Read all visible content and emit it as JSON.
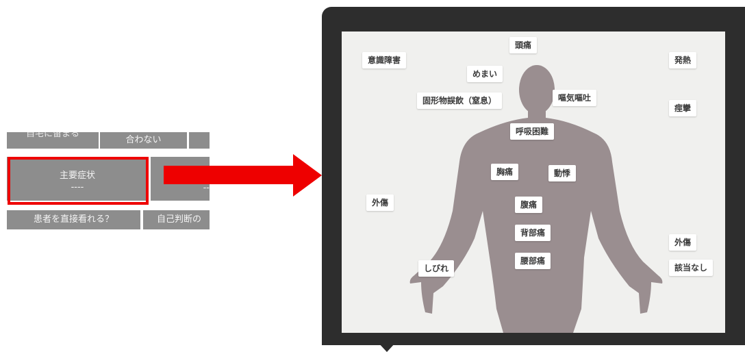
{
  "grid": {
    "top_row": [
      "自宅に留まる",
      "合わない",
      ""
    ],
    "main_row": {
      "label": "主要症状",
      "value": "----",
      "right_value": "--"
    },
    "bottom_row": [
      "患者を直接看れる？",
      "自己判断の"
    ]
  },
  "symptoms": {
    "headache": "頭痛",
    "consciousness": "意識障害",
    "dizziness": "めまい",
    "fever": "発熱",
    "choking": "固形物誤飲（窒息）",
    "nausea": "嘔気嘔吐",
    "convulsion": "痙攣",
    "dyspnea": "呼吸困難",
    "chest_pain": "胸痛",
    "palpitation": "動悸",
    "trauma_left": "外傷",
    "abdominal_pain": "腹痛",
    "back_pain": "背部痛",
    "trauma_right": "外傷",
    "numbness": "しびれ",
    "low_back_pain": "腰部痛",
    "none": "該当なし"
  },
  "colors": {
    "highlight": "#ee0000",
    "body": "#9a8e90",
    "popover": "#2d2d2d"
  }
}
